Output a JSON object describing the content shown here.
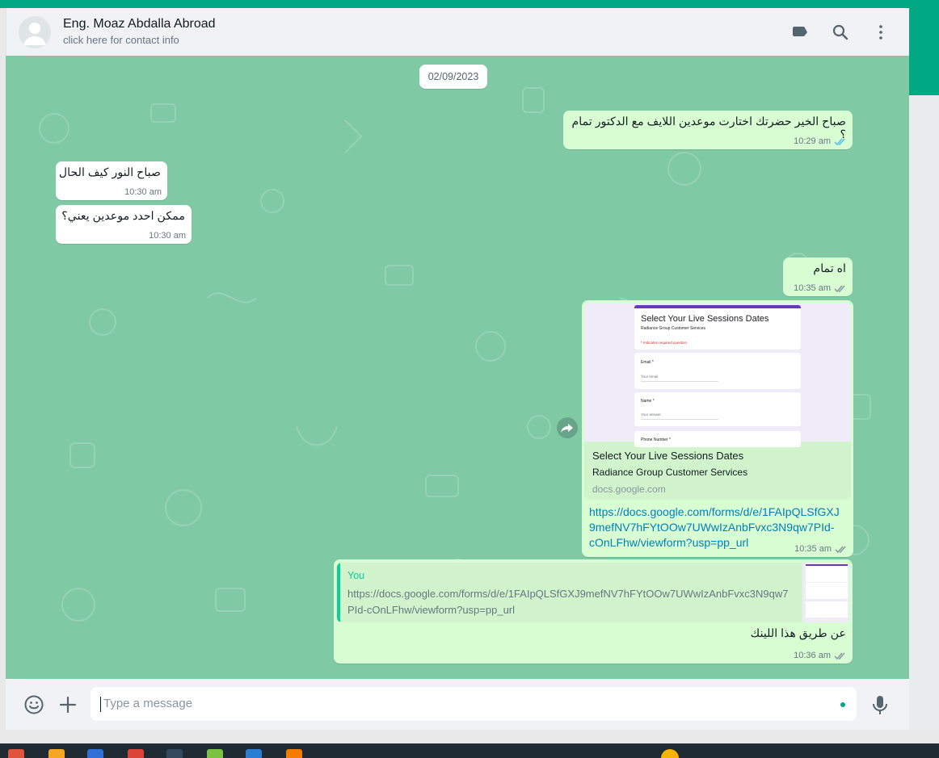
{
  "header": {
    "contact_name": "Eng. Moaz Abdalla Abroad",
    "contact_subtitle": "click here for contact info",
    "icons": [
      "label-icon",
      "search-icon",
      "menu-icon"
    ]
  },
  "chat": {
    "date_chip": "02/09/2023",
    "messages": [
      {
        "text": "صباح الخير حضرتك اختارت موعدين اللايف مع الدكتور تمام ؟",
        "time": "10:29 am",
        "direction": "outgoing"
      },
      {
        "text": "صباح النور كيف الحال",
        "time": "10:30 am",
        "direction": "incoming"
      },
      {
        "text": "ممكن احدد موعدين يعني؟",
        "time": "10:30 am",
        "direction": "incoming"
      },
      {
        "text": "اه تمام",
        "time": "10:35 am",
        "direction": "outgoing"
      },
      {
        "direction": "outgoing",
        "time": "10:35 am",
        "preview": {
          "form_title": "Select Your Live Sessions Dates",
          "form_org": "Radiance Group Customer Services",
          "form_required_note": "* Indicates required question",
          "field_email_label": "Email *",
          "field_email_placeholder": "Your email",
          "field_name_label": "Name *",
          "field_name_placeholder": "Your answer",
          "field_phone_label": "Phone Number *",
          "title": "Select Your Live Sessions Dates",
          "description": "Radiance Group Customer Services",
          "domain": "docs.google.com"
        },
        "link_lines": [
          "https://docs.google.com/forms/d/e/1FAIpQLSfGXJ",
          "9mefNV7hFYtOOw7UWwIzAnbFvxc3N9qw7PId-",
          "cOnLFhw/viewform?usp=pp_url"
        ]
      },
      {
        "direction": "outgoing",
        "time": "10:36 am",
        "quote": {
          "author": "You",
          "text_lines": [
            "https://docs.google.com/forms/d/e/1FAIpQLSfGXJ9mefNV7hFYtOOw7UWwIzAnbFvxc3N9qw7",
            "PId-cOnLFhw/viewform?usp=pp_url"
          ]
        },
        "text": "عن طريق هذا اللينك"
      }
    ]
  },
  "composer": {
    "placeholder": "Type a message",
    "icons": [
      "emoji-icon",
      "attach-plus-icon",
      "microphone-icon"
    ]
  },
  "colors": {
    "accent": "#00a884",
    "outgoing_bubble": "#d9fdd3",
    "incoming_bubble": "#ffffff",
    "chat_background": "#7fc9a5",
    "link": "#027eb5",
    "read_tick": "#53bdeb"
  }
}
